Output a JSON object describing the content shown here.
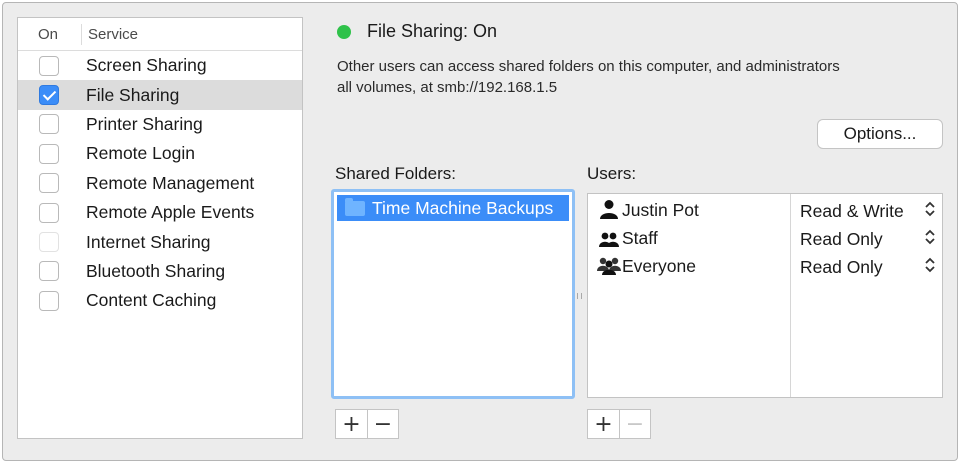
{
  "services": {
    "header_on": "On",
    "header_service": "Service",
    "items": [
      {
        "label": "Screen Sharing",
        "checked": false
      },
      {
        "label": "File Sharing",
        "checked": true
      },
      {
        "label": "Printer Sharing",
        "checked": false
      },
      {
        "label": "Remote Login",
        "checked": false
      },
      {
        "label": "Remote Management",
        "checked": false
      },
      {
        "label": "Remote Apple Events",
        "checked": false
      },
      {
        "label": "Internet Sharing",
        "checked": false,
        "disabled": true
      },
      {
        "label": "Bluetooth Sharing",
        "checked": false
      },
      {
        "label": "Content Caching",
        "checked": false
      }
    ]
  },
  "status": {
    "title": "File Sharing: On",
    "description_line1": "Other users can access shared folders on this computer, and administrators",
    "description_line2": "all volumes, at smb://192.168.1.5",
    "color": "#2fc24a"
  },
  "options_label": "Options...",
  "shared_folders": {
    "label": "Shared Folders:",
    "items": [
      "Time Machine Backups"
    ]
  },
  "users": {
    "label": "Users:",
    "items": [
      {
        "name": "Justin Pot",
        "permission": "Read & Write",
        "icon": "single-user-icon"
      },
      {
        "name": "Staff",
        "permission": "Read Only",
        "icon": "group-icon"
      },
      {
        "name": "Everyone",
        "permission": "Read Only",
        "icon": "everyone-icon"
      }
    ]
  },
  "controls": {
    "add_symbol": "+",
    "remove_symbol": "−"
  },
  "accent_color": "#3b8df8"
}
